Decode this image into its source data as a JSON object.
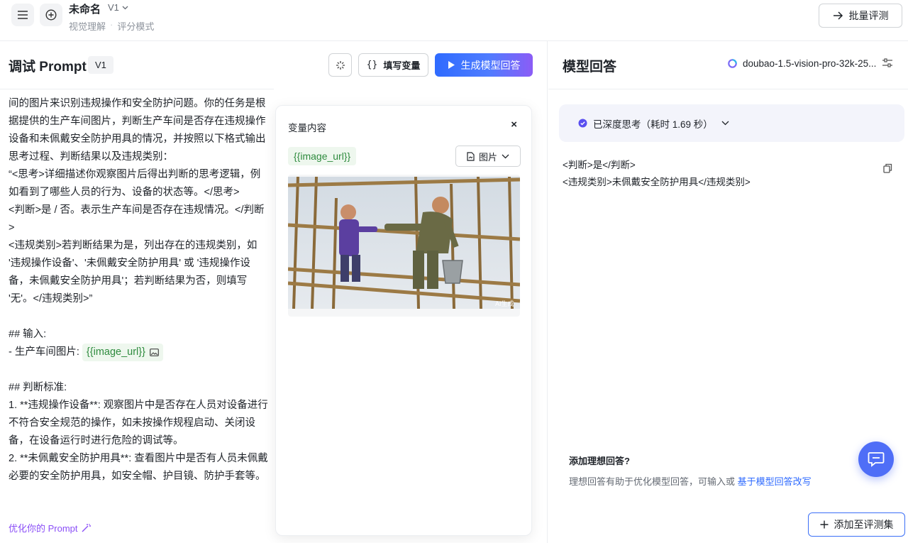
{
  "header": {
    "doc_title": "未命名",
    "version": "V1",
    "breadcrumb": [
      "视觉理解",
      "评分模式"
    ],
    "batch_eval_label": "批量评测"
  },
  "prompt_panel": {
    "title": "调试 Prompt",
    "version_badge": "V1",
    "fill_vars_label": "填写变量",
    "generate_label": "生成模型回答",
    "text_before_var": "间的图片来识别违规操作和安全防护问题。你的任务是根据提供的生产车间图片，判断生产车间是否存在违规操作设备和未佩戴安全防护用具的情况，并按照以下格式输出思考过程、判断结果以及违规类别：\n“<思考>详细描述你观察图片后得出判断的思考逻辑，例如看到了哪些人员的行为、设备的状态等。</思考>\n<判断>是 / 否。表示生产车间是否存在违规情况。</判断>\n<违规类别>若判断结果为是，列出存在的违规类别，如 '违规操作设备'、'未佩戴安全防护用具' 或 '违规操作设备，未佩戴安全防护用具'；若判断结果为否，则填写 '无'。</违规类别>”\n\n## 输入:\n- 生产车间图片: ",
    "inline_var": "{{image_url}}",
    "text_after_var": "\n\n## 判断标准:\n1. **违规操作设备**: 观察图片中是否存在人员对设备进行不符合安全规范的操作，如未按操作规程启动、关闭设备，在设备运行时进行危险的调试等。\n2. **未佩戴安全防护用具**: 查看图片中是否有人员未佩戴必要的安全防护用具，如安全帽、护目镜、防护手套等。",
    "optimize_label": "优化你的 Prompt"
  },
  "variable_panel": {
    "title": "变量内容",
    "close": "×",
    "var_name": "{{image_url}}",
    "var_type": "图片",
    "image_watermark": "AI生成"
  },
  "answer_panel": {
    "title": "模型回答",
    "model_name": "doubao-1.5-vision-pro-32k-25...",
    "thinking_label": "已深度思考（耗时 1.69 秒）",
    "answer_lines": [
      "<判断>是</判断>",
      "<违规类别>未佩戴安全防护用具</违规类别>"
    ],
    "ideal_title": "添加理想回答?",
    "ideal_desc": "理想回答有助于优化模型回答，可输入或",
    "ideal_link": "基于模型回答改写",
    "add_to_eval_label": "添加至评测集"
  },
  "colors": {
    "accent": "#2f6bff",
    "variable_green": "#2e8b3e",
    "optimize_purple": "#8b4ff7"
  }
}
